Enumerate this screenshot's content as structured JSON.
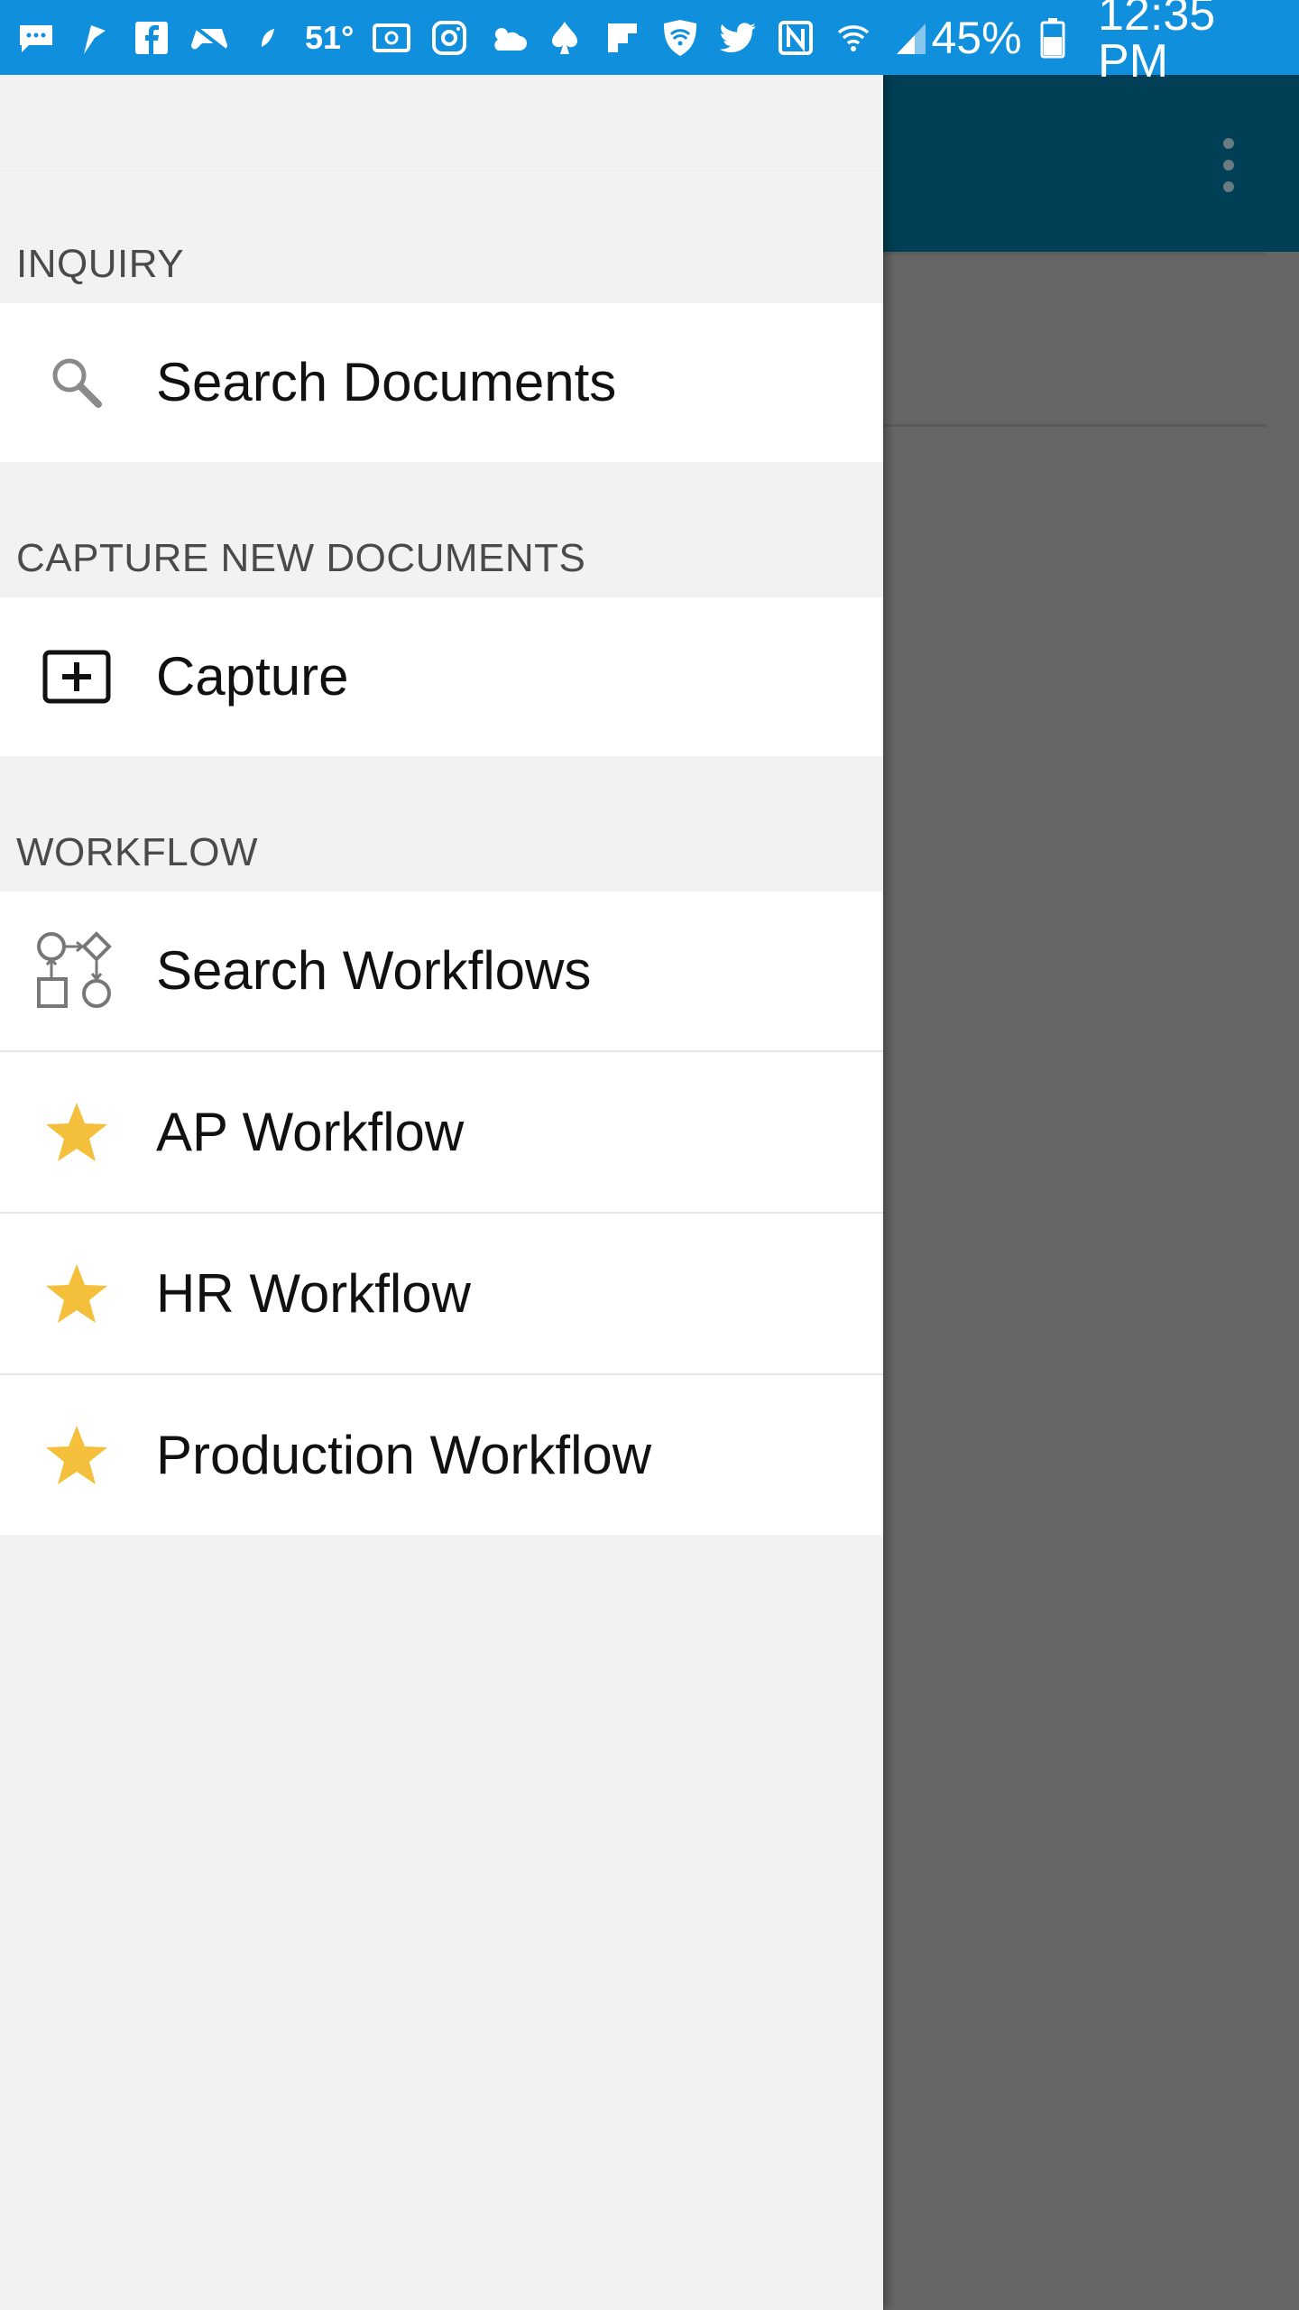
{
  "status_bar": {
    "temperature": "51°",
    "battery": "45%",
    "time": "12:35 PM",
    "icons": [
      "chat-icon",
      "flag-icon",
      "facebook-icon",
      "gamepad-icon",
      "leaf-icon",
      "temperature-text",
      "email-icon",
      "instagram-icon",
      "weather-icon",
      "spade-icon",
      "flipboard-icon",
      "wifi-shield-icon",
      "twitter-icon",
      "nfc-icon",
      "wifi-icon",
      "signal-icon",
      "battery-icon"
    ]
  },
  "colors": {
    "status_bar_bg": "#0f8fdc",
    "toolbar_bg": "#003f56",
    "drawer_bg": "#f2f2f2",
    "star_color": "#f4bf3a",
    "scrim": "#666666"
  },
  "drawer": {
    "sections": [
      {
        "header": "INQUIRY",
        "items": [
          {
            "label": "Search Documents",
            "icon": "search-icon"
          }
        ]
      },
      {
        "header": "CAPTURE NEW DOCUMENTS",
        "items": [
          {
            "label": "Capture",
            "icon": "add-box-icon"
          }
        ]
      },
      {
        "header": "WORKFLOW",
        "items": [
          {
            "label": "Search Workflows",
            "icon": "workflow-diagram-icon"
          },
          {
            "label": "AP Workflow",
            "icon": "star-icon"
          },
          {
            "label": "HR Workflow",
            "icon": "star-icon"
          },
          {
            "label": "Production Workflow",
            "icon": "star-icon"
          }
        ]
      }
    ]
  }
}
